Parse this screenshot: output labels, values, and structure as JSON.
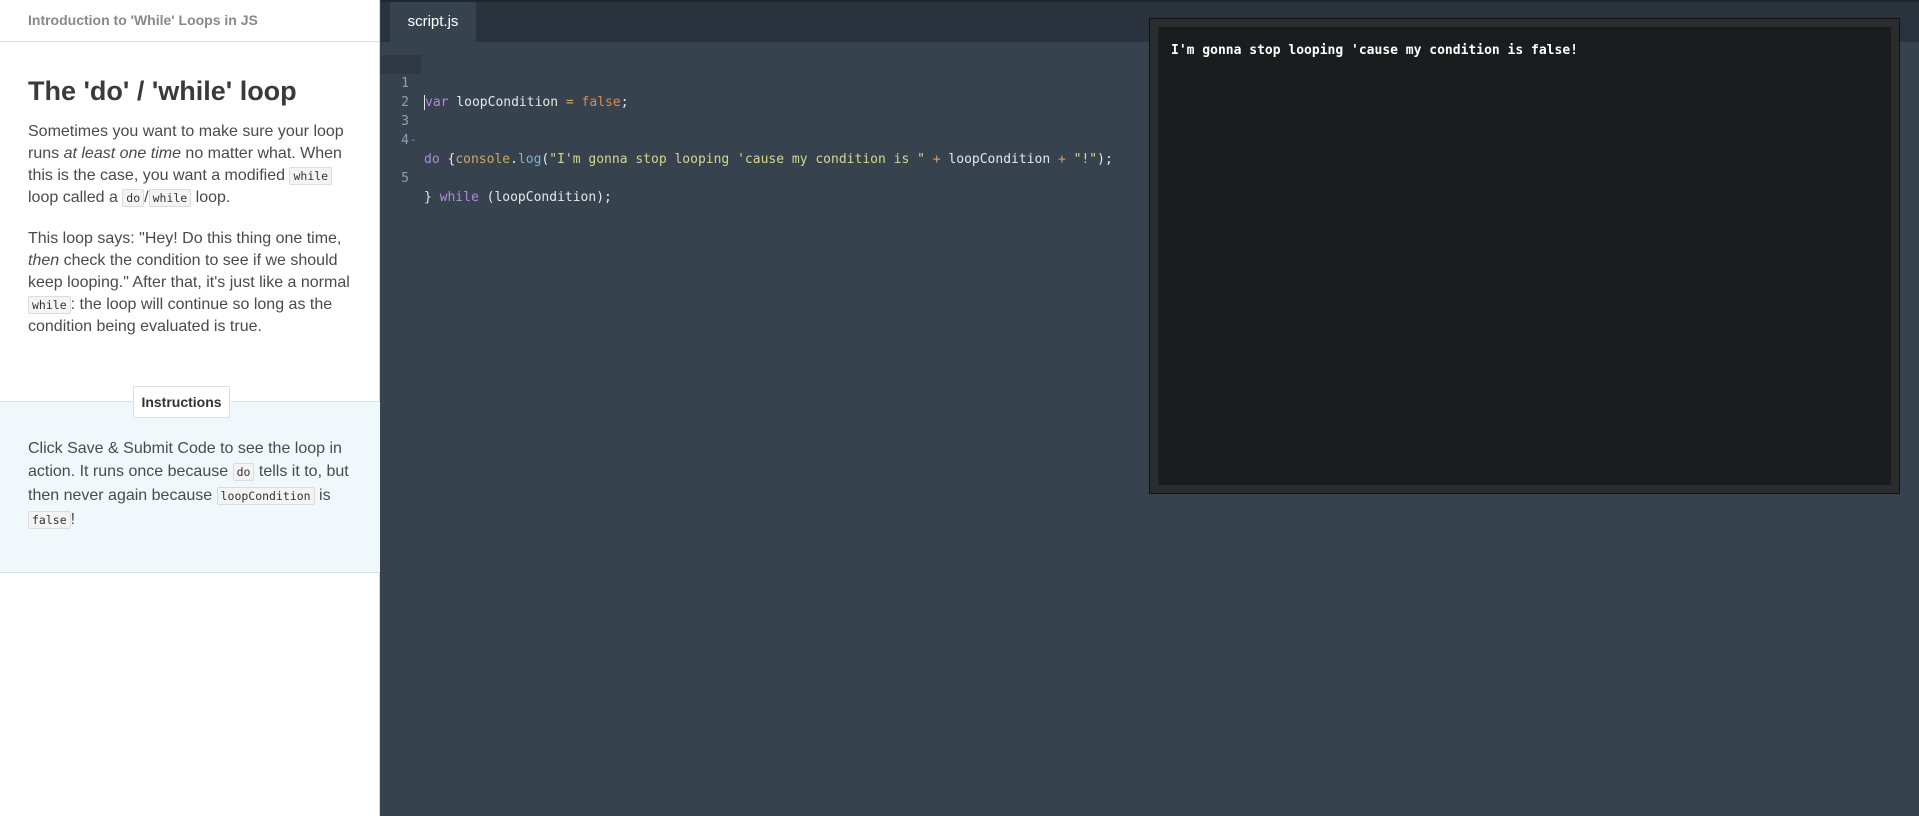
{
  "breadcrumb": "Introduction to 'While' Loops in JS",
  "lesson": {
    "title": "The 'do' / 'while' loop",
    "p1": {
      "a": "Sometimes you want to make sure your loop runs ",
      "em": "at least one time",
      "b": " no matter what. When this is the case, you want a modified ",
      "code1": "while",
      "c": " loop called a ",
      "code2": "do",
      "slash": "/",
      "code3": "while",
      "d": " loop."
    },
    "p2": {
      "a": "This loop says: \"Hey! Do this thing one time, ",
      "em": "then",
      "b": " check the condition to see if we should keep looping.\" After that, it's just like a normal ",
      "code1": "while",
      "c": ": the loop will continue so long as the condition being evaluated is true."
    }
  },
  "instructions": {
    "label": "Instructions",
    "a": "Click Save & Submit Code to see the loop in action. It runs once because ",
    "code1": "do",
    "b": " tells it to, but then never again because ",
    "code2": "loopCondition",
    "c": " is ",
    "code3": "false",
    "d": "!"
  },
  "editor": {
    "tab": "script.js",
    "line_numbers": [
      "1",
      "2",
      "3",
      "4",
      "5"
    ],
    "fold_marker": "-",
    "line1": {
      "kw": "var",
      "name": " loopCondition ",
      "op": "=",
      "sp": " ",
      "bool": "false",
      "end": ";"
    },
    "line3": {
      "kw": "do",
      "rest": " {"
    },
    "line4": {
      "indent": "    ",
      "obj": "console",
      "dot": ".",
      "fn": "log",
      "open": "(",
      "str1": "\"I'm gonna stop looping 'cause my condition is \"",
      "plus1": " + ",
      "var": "loopCondition",
      "plus2": " + ",
      "str2": "\"!\"",
      "close": ");"
    },
    "line5": {
      "brace": "} ",
      "kw": "while",
      "rest": " (loopCondition);"
    }
  },
  "console": {
    "output": "I'm gonna stop looping 'cause my condition is false!"
  },
  "colors": {
    "editor_bg": "#36434f",
    "tabbar_bg": "#2a333d",
    "console_bg": "#1b1c1e",
    "instructions_bg": "#f0f8fb",
    "keyword": "#b08ad6",
    "string": "#d7d58a",
    "boolean": "#e08a45"
  }
}
